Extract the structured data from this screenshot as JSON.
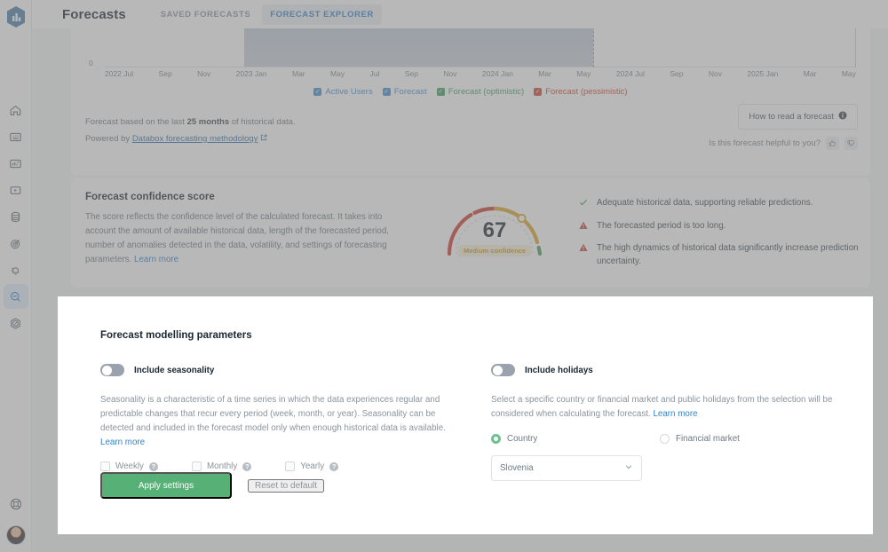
{
  "app": {
    "logo_icon": "databox-hex-logo-icon",
    "page_title": "Forecasts"
  },
  "tabs": [
    {
      "label": "SAVED FORECASTS",
      "active": false
    },
    {
      "label": "FORECAST EXPLORER",
      "active": true
    }
  ],
  "sidebar": {
    "items": [
      {
        "icon": "home-icon",
        "active": false
      },
      {
        "icon": "metrics-123-icon",
        "active": false
      },
      {
        "icon": "dashboard-chart-icon",
        "active": false
      },
      {
        "icon": "video-player-icon",
        "active": false
      },
      {
        "icon": "database-icon",
        "active": false
      },
      {
        "icon": "target-goal-icon",
        "active": false
      },
      {
        "icon": "alert-bell-icon",
        "active": false
      },
      {
        "icon": "forecast-magnifier-icon",
        "active": true
      },
      {
        "icon": "performance-gauge-icon",
        "active": false
      }
    ],
    "bottom": [
      {
        "icon": "help-lifebuoy-icon"
      },
      {
        "icon": "user-avatar"
      }
    ]
  },
  "chart_data": {
    "type": "line",
    "title": "",
    "xlabel": "",
    "ylabel": "",
    "y_zero_label": "0",
    "categories": [
      "2022 Jul",
      "Sep",
      "Nov",
      "2023 Jan",
      "Mar",
      "May",
      "Jul",
      "Sep",
      "Nov",
      "2024 Jan",
      "Mar",
      "May",
      "2024 Jul",
      "Sep",
      "Nov",
      "2025 Jan",
      "Mar",
      "May"
    ],
    "series": [
      {
        "name": "Active Users",
        "color": "#3e8ed0"
      },
      {
        "name": "Forecast",
        "color": "#3e8ed0"
      },
      {
        "name": "Forecast (optimistic)",
        "color": "#3d9e63"
      },
      {
        "name": "Forecast (pessimistic)",
        "color": "#d0432c"
      }
    ],
    "legend": [
      {
        "label": "Active Users",
        "color": "#3e8ed0",
        "checked": true
      },
      {
        "label": "Forecast",
        "color": "#3e8ed0",
        "checked": true
      },
      {
        "label": "Forecast (optimistic)",
        "color": "#3d9e63",
        "checked": true
      },
      {
        "label": "Forecast (pessimistic)",
        "color": "#d0432c",
        "checked": true
      }
    ],
    "shaded_region": {
      "from": "2023 Jan",
      "to": "2024 May",
      "color": "#b7c4d6"
    },
    "forecast_start_marker": "2024 Jun",
    "grid": false,
    "legend_position": "bottom"
  },
  "chart_footer": {
    "based_on_prefix": "Forecast based on the last ",
    "based_on_strong": "25 months",
    "based_on_suffix": " of historical data.",
    "powered_by_prefix": "Powered by ",
    "powered_by_link": "Databox forecasting methodology",
    "external_link_icon": "external-link-icon",
    "how_to_read": "How to read a forecast",
    "info_icon": "info-icon",
    "helpful_question": "Is this forecast helpful to you?",
    "thumb_up_icon": "thumbs-up-icon",
    "thumb_down_icon": "thumbs-down-icon"
  },
  "confidence": {
    "title": "Forecast confidence score",
    "description": "The score reflects the confidence level of the calculated forecast. It takes into account the amount of available historical data, length of the forecasted period, number of anomalies detected in the data, volatility, and settings of forecasting parameters. ",
    "learn_more": "Learn more",
    "score": "67",
    "score_label": "Medium confidence",
    "gauge_colors": {
      "low": "#cf3a2b",
      "medium": "#d9a526",
      "high": "#4a9c5e"
    },
    "checks": [
      {
        "type": "ok",
        "icon": "check-icon",
        "text": "Adequate historical data, supporting reliable predictions."
      },
      {
        "type": "warn",
        "icon": "warning-triangle-icon",
        "text": "The forecasted period is too long."
      },
      {
        "type": "warn",
        "icon": "warning-triangle-icon",
        "text": "The high dynamics of historical data significantly increase prediction uncertainty."
      }
    ]
  },
  "modal": {
    "title": "Forecast modelling parameters",
    "seasonality": {
      "toggle_label": "Include seasonality",
      "toggle_on": false,
      "description": "Seasonality is a characteristic of a time series in which the data experiences regular and predictable changes that recur every period (week, month, or year). Seasonality can be detected and included in the forecast model only when enough historical data is available. ",
      "learn_more": "Learn more",
      "options": [
        {
          "label": "Weekly",
          "checked": false,
          "help_icon": "help-circle-icon"
        },
        {
          "label": "Monthly",
          "checked": false,
          "help_icon": "help-circle-icon"
        },
        {
          "label": "Yearly",
          "checked": false,
          "help_icon": "help-circle-icon"
        }
      ]
    },
    "holidays": {
      "toggle_label": "Include holidays",
      "toggle_on": false,
      "description": "Select a specific country or financial market and public holidays from the selection will be considered when calculating the forecast. ",
      "learn_more": "Learn more",
      "radios": [
        {
          "label": "Country",
          "selected": true
        },
        {
          "label": "Financial market",
          "selected": false
        }
      ],
      "select_value": "Slovenia",
      "select_chevron_icon": "chevron-down-icon"
    },
    "apply_label": "Apply settings",
    "reset_label": "Reset to default",
    "accent_color": "#57b177"
  }
}
